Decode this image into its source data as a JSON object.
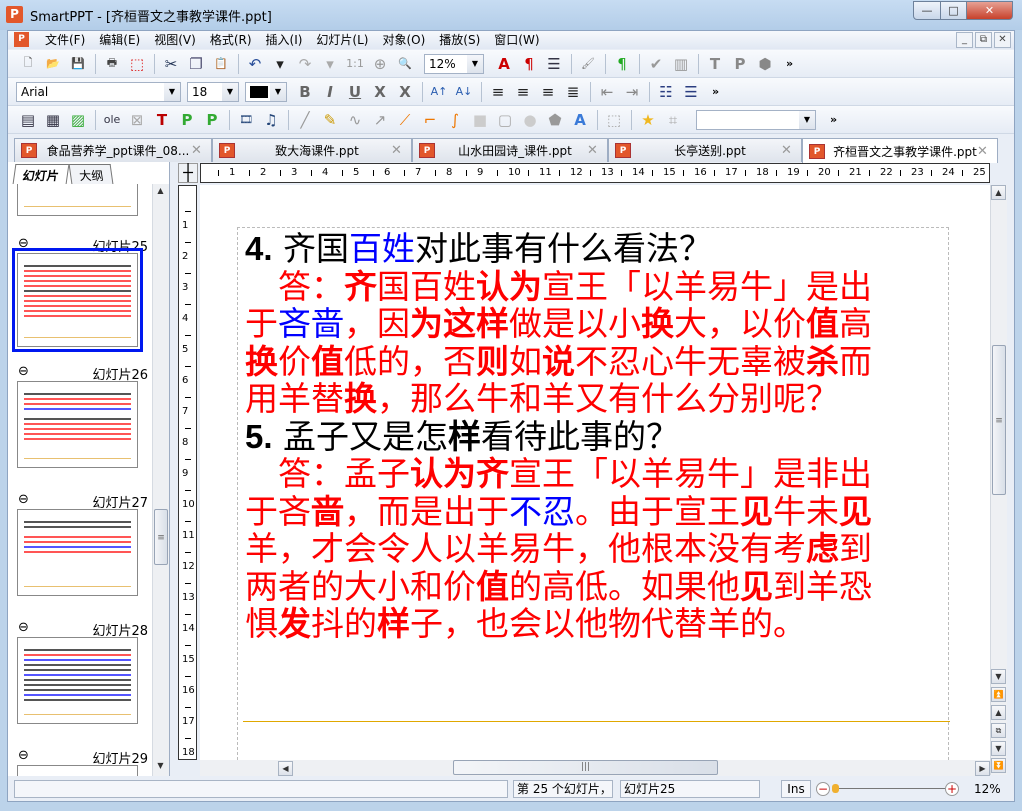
{
  "window": {
    "title": "SmartPPT - [齐桓晋文之事教学课件.ppt]",
    "app_icon": "P",
    "minimize": "—",
    "maximize": "□",
    "close": "✕"
  },
  "menu": [
    "文件(F)",
    "编辑(E)",
    "视图(V)",
    "格式(R)",
    "插入(I)",
    "幻灯片(L)",
    "对象(O)",
    "播放(S)",
    "窗口(W)"
  ],
  "mdi": {
    "minimize": "_",
    "restore": "⧉",
    "close": "✕"
  },
  "toolbar1": {
    "icons": [
      {
        "name": "new-file-icon",
        "g": "🗋",
        "c": "#555"
      },
      {
        "name": "open-folder-icon",
        "g": "📂",
        "c": "#d9a520"
      },
      {
        "name": "save-icon",
        "g": "💾",
        "c": "#3a62b0"
      },
      "sep",
      {
        "name": "print-icon",
        "g": "🖶",
        "c": "#444"
      },
      {
        "name": "export-pdf-icon",
        "g": "⬚",
        "c": "#d22"
      },
      "sep",
      {
        "name": "cut-icon",
        "g": "✂",
        "c": "#235"
      },
      {
        "name": "copy-icon",
        "g": "❐",
        "c": "#557"
      },
      {
        "name": "paste-icon",
        "g": "📋",
        "c": "#999"
      },
      "sep",
      {
        "name": "undo-icon",
        "g": "↶",
        "c": "#2a4f9a"
      },
      {
        "name": "undo-dropdown-icon",
        "g": "▾",
        "c": "#222"
      },
      {
        "name": "redo-icon",
        "g": "↷",
        "c": "#aaa"
      },
      {
        "name": "redo-dropdown-icon",
        "g": "▾",
        "c": "#aaa"
      },
      {
        "name": "actual-size-icon",
        "g": "1:1",
        "c": "#999"
      },
      {
        "name": "zoom-in-icon",
        "g": "⊕",
        "c": "#999"
      },
      {
        "name": "zoom-icon",
        "g": "🔍",
        "c": "#999"
      },
      "zoom",
      {
        "name": "font-color-a-icon",
        "g": "A",
        "c": "#c00"
      },
      {
        "name": "paragraph-format-icon",
        "g": "¶",
        "c": "#c00"
      },
      {
        "name": "numbering-icon",
        "g": "☰",
        "c": "#334"
      },
      "sep",
      {
        "name": "format-painter-icon",
        "g": "🖌",
        "c": "#888"
      },
      "sep",
      {
        "name": "show-marks-icon",
        "g": "¶",
        "c": "#2a2"
      },
      "sep",
      {
        "name": "spell-check-icon",
        "g": "✔",
        "c": "#999"
      },
      {
        "name": "chart-icon",
        "g": "▥",
        "c": "#999"
      },
      "sep",
      {
        "name": "text-box-t-icon",
        "g": "T",
        "c": "#888"
      },
      {
        "name": "text-box-p-icon",
        "g": "P",
        "c": "#888"
      },
      {
        "name": "eraser-icon",
        "g": "⬢",
        "c": "#888"
      },
      "more"
    ],
    "zoom_value": "12%",
    "more": "»"
  },
  "toolbar2": {
    "font": "Arial",
    "size": "18",
    "color": "#000000",
    "icons": [
      {
        "name": "bold-icon",
        "g": "B",
        "c": "#666"
      },
      {
        "name": "italic-icon",
        "g": "I",
        "c": "#666"
      },
      {
        "name": "underline-icon",
        "g": "U",
        "c": "#666"
      },
      {
        "name": "strikethrough-icon",
        "g": "X",
        "c": "#666"
      },
      {
        "name": "double-strikethrough-icon",
        "g": "X",
        "c": "#666"
      },
      "sep",
      {
        "name": "increase-font-icon",
        "g": "A↑",
        "c": "#2a5db0"
      },
      {
        "name": "decrease-font-icon",
        "g": "A↓",
        "c": "#2a5db0"
      },
      "sep",
      {
        "name": "align-left-icon",
        "g": "≡",
        "c": "#222"
      },
      {
        "name": "align-right-icon",
        "g": "≡",
        "c": "#222"
      },
      {
        "name": "align-center-icon",
        "g": "≡",
        "c": "#222"
      },
      {
        "name": "justify-icon",
        "g": "≣",
        "c": "#222"
      },
      "sep",
      {
        "name": "decrease-indent-icon",
        "g": "⇤",
        "c": "#888"
      },
      {
        "name": "increase-indent-icon",
        "g": "⇥",
        "c": "#888"
      },
      "sep",
      {
        "name": "bullet-list-icon",
        "g": "☷",
        "c": "#2a3d80"
      },
      {
        "name": "numbered-list-icon",
        "g": "☰",
        "c": "#2a3d80"
      },
      "more"
    ],
    "more": "»"
  },
  "toolbar3": {
    "icons": [
      {
        "name": "text-frame-icon",
        "g": "▤",
        "c": "#334"
      },
      {
        "name": "table-icon",
        "g": "▦",
        "c": "#334"
      },
      {
        "name": "picture-icon",
        "g": "▨",
        "c": "#3a3"
      },
      "sep",
      {
        "name": "ole-object-icon",
        "g": "ole",
        "c": "#334"
      },
      {
        "name": "placeholder-icon",
        "g": "⊠",
        "c": "#aaa"
      },
      {
        "name": "insert-title-icon",
        "g": "T",
        "c": "#b00"
      },
      {
        "name": "insert-p-icon",
        "g": "P",
        "c": "#3a3"
      },
      {
        "name": "insert-p-alt-icon",
        "g": "P",
        "c": "#3a3"
      },
      "sep",
      {
        "name": "video-icon",
        "g": "🎞",
        "c": "#247"
      },
      {
        "name": "audio-icon",
        "g": "♫",
        "c": "#247"
      },
      "sep",
      {
        "name": "line-icon",
        "g": "╱",
        "c": "#999"
      },
      {
        "name": "pencil-icon",
        "g": "✎",
        "c": "#c90"
      },
      {
        "name": "curve-icon",
        "g": "∿",
        "c": "#999"
      },
      {
        "name": "arrow-icon",
        "g": "↗",
        "c": "#999"
      },
      {
        "name": "connector-straight-icon",
        "g": "⟋",
        "c": "#e70"
      },
      {
        "name": "connector-elbow-icon",
        "g": "⌐",
        "c": "#e70"
      },
      {
        "name": "connector-curve-icon",
        "g": "∫",
        "c": "#e70"
      },
      {
        "name": "rectangle-icon",
        "g": "■",
        "c": "#ccc"
      },
      {
        "name": "rounded-rect-icon",
        "g": "▢",
        "c": "#aaa"
      },
      {
        "name": "ellipse-icon",
        "g": "●",
        "c": "#ccc"
      },
      {
        "name": "shapes-icon",
        "g": "⬟",
        "c": "#999"
      },
      {
        "name": "wordart-icon",
        "g": "A",
        "c": "#3a7ad8"
      },
      "sep",
      {
        "name": "group-icon",
        "g": "⬚",
        "c": "#aaa"
      },
      "sep",
      {
        "name": "star-animation-icon",
        "g": "★",
        "c": "#f0b820"
      },
      {
        "name": "crop-icon",
        "g": "⌗",
        "c": "#aaa"
      },
      "combo",
      "more"
    ],
    "more": "»"
  },
  "doc_tabs": [
    {
      "label": "食品营养学_ppt课件_08...",
      "active": false
    },
    {
      "label": "致大海课件.ppt",
      "active": false
    },
    {
      "label": "山水田园诗_课件.ppt",
      "active": false
    },
    {
      "label": "长亭送别.ppt",
      "active": false
    },
    {
      "label": "齐桓晋文之事教学课件.ppt",
      "active": true
    }
  ],
  "tab_close": "✕",
  "panel_tabs": [
    "幻灯片",
    "大纲"
  ],
  "thumbnails": [
    {
      "label": "幻灯片25",
      "selected": true
    },
    {
      "label": "幻灯片26",
      "selected": false
    },
    {
      "label": "幻灯片27",
      "selected": false
    },
    {
      "label": "幻灯片28",
      "selected": false
    },
    {
      "label": "幻灯片29",
      "selected": false
    }
  ],
  "ruler_h": [
    "1",
    "2",
    "3",
    "4",
    "5",
    "6",
    "7",
    "8",
    "9",
    "10",
    "11",
    "12",
    "13",
    "14",
    "15",
    "16",
    "17",
    "18",
    "19",
    "20",
    "21",
    "22",
    "23",
    "24",
    "25"
  ],
  "ruler_v": [
    "1",
    "2",
    "3",
    "4",
    "5",
    "6",
    "7",
    "8",
    "9",
    "10",
    "11",
    "12",
    "13",
    "14",
    "15",
    "16",
    "17",
    "18"
  ],
  "slide": {
    "lines": [
      [
        [
          "4.",
          "kb"
        ],
        [
          " 齐国",
          "k"
        ],
        [
          "百姓",
          "b"
        ],
        [
          "对此事有什么看法？",
          "k"
        ]
      ],
      [
        [
          "　答：",
          "r"
        ],
        [
          "齐",
          "rb"
        ],
        [
          "国百姓",
          "r"
        ],
        [
          "认为",
          "rb"
        ],
        [
          "宣王「以羊易牛」是出",
          "r"
        ]
      ],
      [
        [
          "于",
          "r"
        ],
        [
          "吝啬",
          "b"
        ],
        [
          "，因",
          "r"
        ],
        [
          "为这样",
          "rb"
        ],
        [
          "做是以小",
          "r"
        ],
        [
          "换",
          "rb"
        ],
        [
          "大，以价",
          "r"
        ],
        [
          "值",
          "rb"
        ],
        [
          "高",
          "r"
        ]
      ],
      [
        [
          "换",
          "rb"
        ],
        [
          "价",
          "r"
        ],
        [
          "值",
          "rb"
        ],
        [
          "低的，否",
          "r"
        ],
        [
          "则",
          "rb"
        ],
        [
          "如",
          "r"
        ],
        [
          "说",
          "rb"
        ],
        [
          "不忍心牛无辜被",
          "r"
        ],
        [
          "杀",
          "rb"
        ],
        [
          "而",
          "r"
        ]
      ],
      [
        [
          "用羊替",
          "r"
        ],
        [
          "换",
          "rb"
        ],
        [
          "，那么牛和羊又有什么分别呢？",
          "r"
        ]
      ],
      [
        [
          "5.",
          "kb"
        ],
        [
          " 孟子又是怎",
          "k"
        ],
        [
          "样",
          "kb"
        ],
        [
          "看待此事的？",
          "k"
        ]
      ],
      [
        [
          "　答：孟子",
          "r"
        ],
        [
          "认为齐",
          "rb"
        ],
        [
          "宣王「以羊易牛」是非出",
          "r"
        ]
      ],
      [
        [
          "于吝",
          "r"
        ],
        [
          "啬",
          "rb"
        ],
        [
          "，而是出于",
          "r"
        ],
        [
          "不忍",
          "b"
        ],
        [
          "。由于宣王",
          "r"
        ],
        [
          "见",
          "rb"
        ],
        [
          "牛未",
          "r"
        ],
        [
          "见",
          "rb"
        ]
      ],
      [
        [
          "羊，才会令人以羊易牛，他根本没有考",
          "r"
        ],
        [
          "虑",
          "rb"
        ],
        [
          "到",
          "r"
        ]
      ],
      [
        [
          "两者的大小和价",
          "r"
        ],
        [
          "值",
          "rb"
        ],
        [
          "的高低。如果他",
          "r"
        ],
        [
          "见",
          "rb"
        ],
        [
          "到羊恐",
          "r"
        ]
      ],
      [
        [
          "惧",
          "r"
        ],
        [
          "发",
          "rb"
        ],
        [
          "抖的",
          "r"
        ],
        [
          "样",
          "rb"
        ],
        [
          "子，也会以他物代替羊的。",
          "r"
        ]
      ]
    ]
  },
  "status": {
    "slide_pos": "第 25 个幻灯片，",
    "slide_name": "幻灯片25",
    "mode": "Ins",
    "zoom": "12%",
    "zoom_level_percent": 12,
    "zoom_minus": "−",
    "zoom_plus": "+"
  }
}
